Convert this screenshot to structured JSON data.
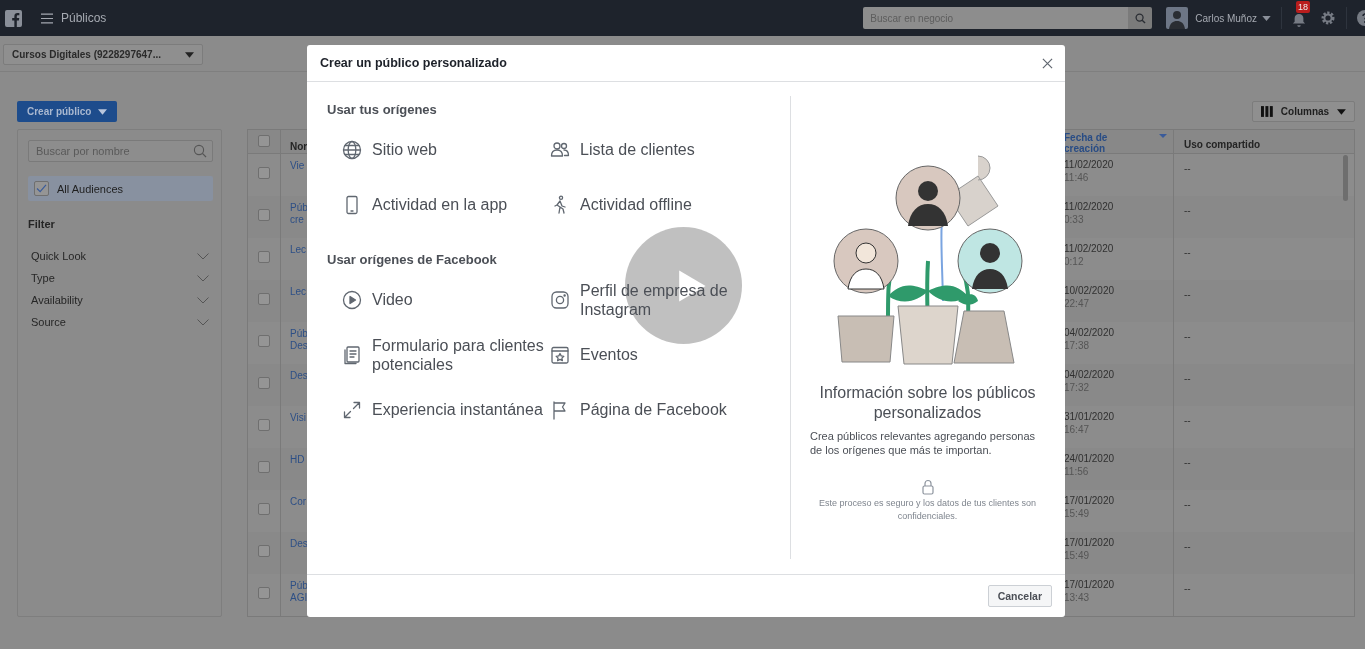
{
  "top_bar": {
    "title": "Públicos",
    "search": {
      "placeholder": "Buscar en negocio"
    },
    "user": "Carlos Muñoz",
    "notifications": "18"
  },
  "account_selector": "Cursos Digitales (9228297647...",
  "create_button": "Crear público",
  "columns_button": "Columnas",
  "sidebar": {
    "search": {
      "placeholder": "Buscar por nombre"
    },
    "audience": {
      "label": "All Audiences",
      "checked": true,
      "selected": true
    },
    "filter_title": "Filter",
    "filters": [
      "Quick Look",
      "Type",
      "Availability",
      "Source"
    ]
  },
  "table": {
    "columns": [
      "Nor",
      "Fecha de creación",
      "Uso compartido"
    ],
    "all_checked": false,
    "rows": [
      {
        "checked": false,
        "name": [
          "Vie"
        ],
        "date": "11/02/2020",
        "time": "11:46",
        "sharing": "--"
      },
      {
        "checked": false,
        "name": [
          "Púb",
          "cre"
        ],
        "date": "11/02/2020",
        "time": "0:33",
        "sharing": "--"
      },
      {
        "checked": false,
        "name": [
          "Lec"
        ],
        "date": "11/02/2020",
        "time": "0:12",
        "sharing": "--"
      },
      {
        "checked": false,
        "name": [
          "Lec"
        ],
        "date": "10/02/2020",
        "time": "22:47",
        "sharing": "--"
      },
      {
        "checked": false,
        "name": [
          "Púb",
          "Des"
        ],
        "date": "04/02/2020",
        "time": "17:38",
        "sharing": "--"
      },
      {
        "checked": false,
        "name": [
          "Des"
        ],
        "date": "04/02/2020",
        "time": "17:32",
        "sharing": "--"
      },
      {
        "checked": false,
        "name": [
          "Visi"
        ],
        "date": "31/01/2020",
        "time": "16:47",
        "sharing": "--"
      },
      {
        "checked": false,
        "name": [
          "HD"
        ],
        "date": "24/01/2020",
        "time": "11:56",
        "sharing": "--"
      },
      {
        "checked": false,
        "name": [
          "Cor"
        ],
        "date": "17/01/2020",
        "time": "15:49",
        "sharing": "--"
      },
      {
        "checked": false,
        "name": [
          "Des"
        ],
        "date": "17/01/2020",
        "time": "15:49",
        "sharing": "--"
      },
      {
        "checked": false,
        "name": [
          "Púb",
          "AGI"
        ],
        "date": "17/01/2020",
        "time": "13:43",
        "sharing": "--"
      }
    ]
  },
  "dialog": {
    "title": "Crear un público personalizado",
    "sections": [
      {
        "title": "Usar tus orígenes",
        "items": [
          "Sitio web",
          "Lista de clientes",
          "Actividad en la app",
          "Actividad offline"
        ]
      },
      {
        "title": "Usar orígenes de Facebook",
        "items": [
          "Video",
          "Perfil de empresa de Instagram",
          "Formulario para clientes potenciales",
          "Eventos",
          "Experiencia instantánea",
          "Página de Facebook"
        ]
      }
    ],
    "info": {
      "title": "Información sobre los públicos personalizados",
      "text": "Crea públicos relevantes agregando personas de los orígenes que más te importan.",
      "security_note": "Este proceso es seguro y los datos de tus clientes son confidenciales."
    },
    "cancel_button": "Cancelar"
  },
  "player": {
    "paused": true
  }
}
